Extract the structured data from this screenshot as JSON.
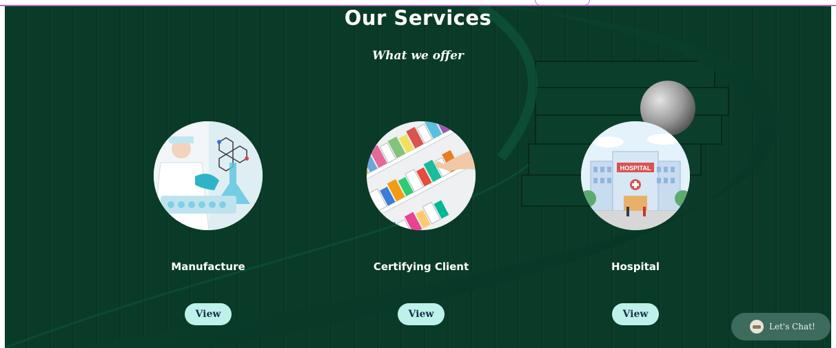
{
  "section": {
    "title": "Our Services",
    "subtitle": "What we offer"
  },
  "services": [
    {
      "name": "Manufacture",
      "button": "View",
      "image_icon": "laboratory-scientist-image"
    },
    {
      "name": "Certifying Client",
      "button": "View",
      "image_icon": "pharmacy-shelf-image"
    },
    {
      "name": "Hospital",
      "button": "View",
      "image_icon": "hospital-building-image",
      "sign": "HOSPITAL"
    }
  ],
  "chat": {
    "label": "Let's Chat!"
  },
  "colors": {
    "background": "#0a3b28",
    "button": "#bdf2ea",
    "button_text": "#17324a",
    "chat": "#3d6b5d",
    "accent_line": "#b36fc8"
  }
}
